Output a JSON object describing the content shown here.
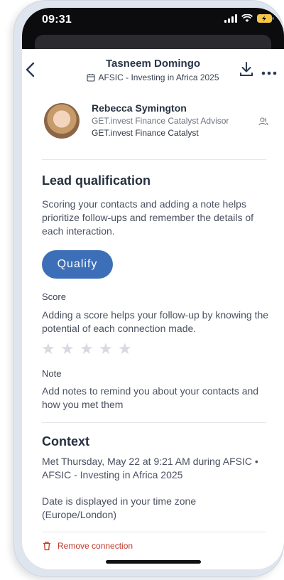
{
  "status_bar": {
    "time": "09:31"
  },
  "header": {
    "title": "Tasneem Domingo",
    "event": "AFSIC - Investing in Africa 2025",
    "icons": {
      "back": "chevron-left-icon",
      "download": "download-icon",
      "more": "more-horizontal-icon"
    }
  },
  "profile": {
    "name": "Rebecca Symington",
    "role": "GET.invest Finance Catalyst Advisor",
    "organization": "GET.invest Finance Catalyst",
    "icon": "contact-icon"
  },
  "lead_qualification": {
    "title": "Lead qualification",
    "description": "Scoring your contacts and adding a note helps prioritize follow-ups and remember the details of each interaction.",
    "qualify_label": "Qualify",
    "score_label": "Score",
    "score_description": "Adding a score helps your follow-up by knowing the potential of each connection made.",
    "score_value": 0,
    "score_max": 5,
    "note_label": "Note",
    "note_description": "Add notes to remind you about your contacts and how you met them"
  },
  "context": {
    "title": "Context",
    "met_text": "Met Thursday, May 22 at 9:21 AM during AFSIC • AFSIC - Investing in Africa 2025",
    "timezone_text": "Date is displayed in your time zone (Europe/London)"
  },
  "actions": {
    "remove_label": "Remove connection"
  },
  "colors": {
    "accent": "#3c6fb7",
    "danger": "#c0392b",
    "star_empty": "#d7dbe1"
  }
}
